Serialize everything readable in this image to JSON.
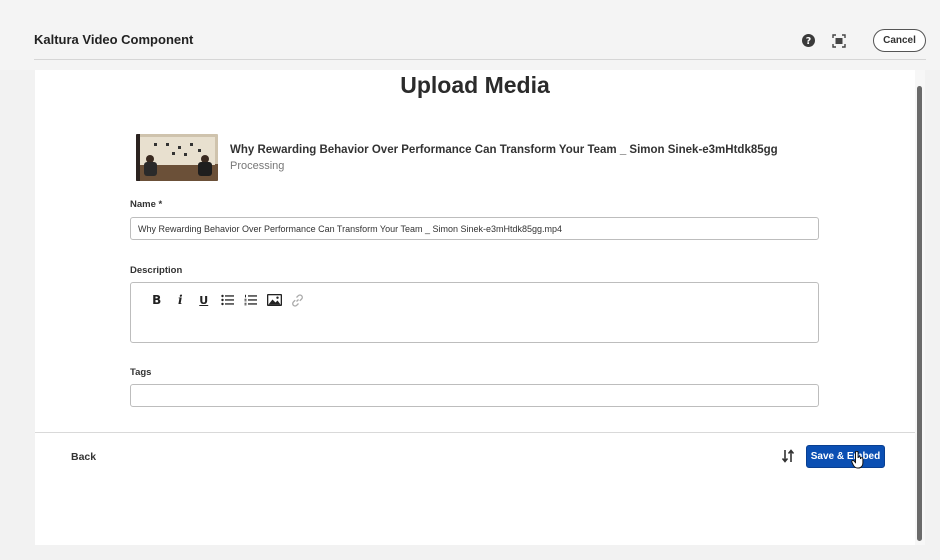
{
  "header": {
    "title": "Kaltura Video Component",
    "cancel_label": "Cancel"
  },
  "main": {
    "page_title": "Upload Media",
    "media": {
      "title": "Why Rewarding Behavior Over Performance Can Transform Your Team _ Simon Sinek-e3mHtdk85gg",
      "status": "Processing"
    },
    "form": {
      "name_label": "Name *",
      "name_value": "Why Rewarding Behavior Over Performance Can Transform Your Team _ Simon Sinek-e3mHtdk85gg.mp4",
      "description_label": "Description",
      "description_value": "",
      "tags_label": "Tags",
      "tags_value": ""
    },
    "editor_toolbar": {
      "bold": "B",
      "italic": "i",
      "underline": "U"
    }
  },
  "footer": {
    "back_label": "Back",
    "save_label": "Save & Embed"
  },
  "icons": [
    "help-icon",
    "fullscreen-icon",
    "bold-icon",
    "italic-icon",
    "underline-icon",
    "bullet-list-icon",
    "numbered-list-icon",
    "image-icon",
    "link-icon",
    "sort-icon",
    "cursor-icon"
  ],
  "colors": {
    "primary": "#0b4fb3",
    "background": "#f2f2f2",
    "panel": "#ffffff",
    "text": "#2c2c2c",
    "muted": "#777777"
  }
}
